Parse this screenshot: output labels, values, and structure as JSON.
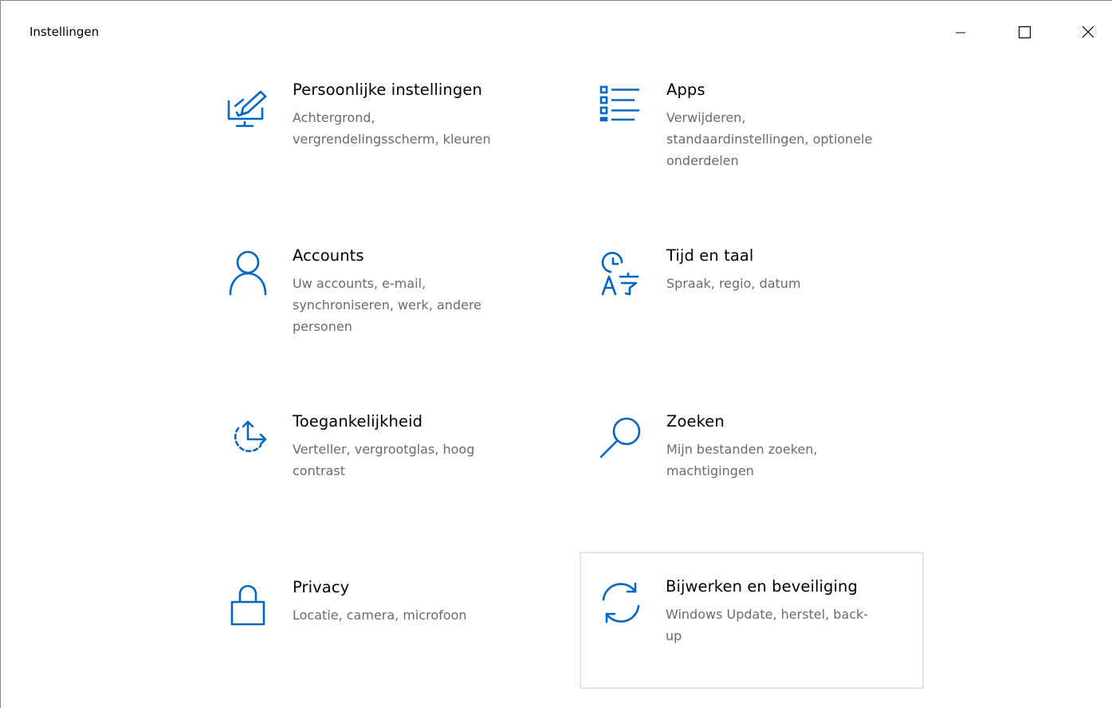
{
  "window": {
    "title": "Instellingen",
    "controls": {
      "minimize": "minimize-icon",
      "maximize": "maximize-icon",
      "close": "close-icon"
    }
  },
  "accent_color": "#0067c0",
  "tiles": [
    {
      "name": "Persoonlijke instellingen",
      "icon": "personalization-icon",
      "desc_lines": [
        "Achtergrond,",
        "vergrendelingsscherm, kleuren"
      ]
    },
    {
      "name": "Apps",
      "icon": "apps-list-icon",
      "desc_lines": [
        "Verwijderen,",
        "standaardinstellingen, optionele",
        "onderdelen"
      ]
    },
    {
      "name": "Accounts",
      "icon": "person-icon",
      "desc_lines": [
        "Uw accounts, e-mail,",
        "synchroniseren, werk, andere",
        "personen"
      ]
    },
    {
      "name": "Tijd en taal",
      "icon": "time-language-icon",
      "desc_lines": [
        "Spraak, regio, datum"
      ]
    },
    {
      "name": "Toegankelijkheid",
      "icon": "ease-of-access-icon",
      "desc_lines": [
        "Verteller, vergrootglas, hoog",
        "contrast"
      ]
    },
    {
      "name": "Zoeken",
      "icon": "search-icon",
      "desc_lines": [
        "Mijn bestanden zoeken,",
        "machtigingen"
      ]
    },
    {
      "name": "Privacy",
      "icon": "lock-icon",
      "desc_lines": [
        "Locatie, camera, microfoon"
      ]
    },
    {
      "name": "Bijwerken en beveiliging",
      "icon": "sync-icon",
      "desc_lines": [
        "Windows Update, herstel, back-",
        "up"
      ]
    }
  ]
}
